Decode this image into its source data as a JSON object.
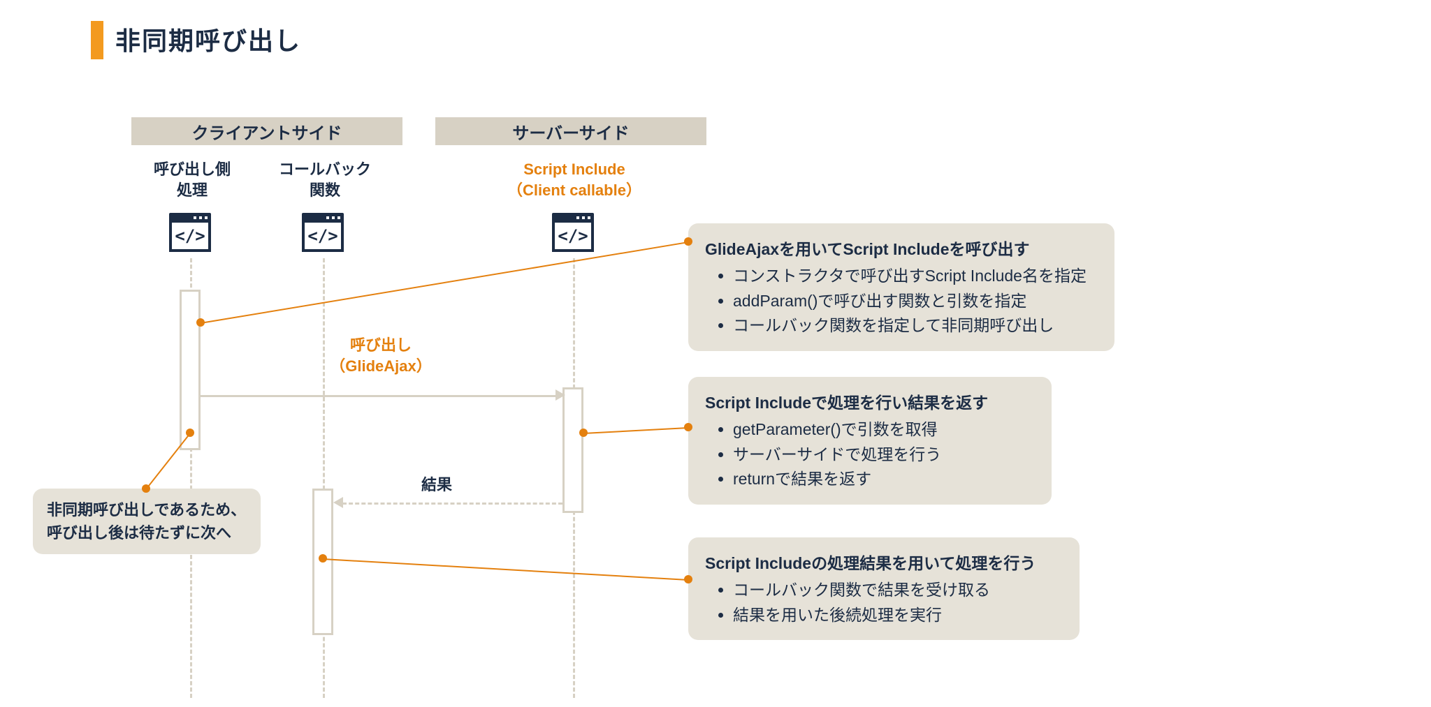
{
  "title": "非同期呼び出し",
  "headers": {
    "client": "クライアントサイド",
    "server": "サーバーサイド"
  },
  "lanes": {
    "caller": "呼び出し側\n処理",
    "callback": "コールバック\n関数",
    "server": "Script Include\n（Client callable）"
  },
  "messages": {
    "call": "呼び出し\n（GlideAjax）",
    "result": "結果"
  },
  "annotations": {
    "a1": {
      "title": "GlideAjaxを用いてScript Includeを呼び出す",
      "items": [
        "コンストラクタで呼び出すScript Include名を指定",
        "addParam()で呼び出す関数と引数を指定",
        "コールバック関数を指定して非同期呼び出し"
      ]
    },
    "a2": {
      "title": "Script Includeで処理を行い結果を返す",
      "items": [
        "getParameter()で引数を取得",
        "サーバーサイドで処理を行う",
        "returnで結果を返す"
      ]
    },
    "a3": {
      "title": "Script Includeの処理結果を用いて処理を行う",
      "items": [
        "コールバック関数で結果を受け取る",
        "結果を用いた後続処理を実行"
      ]
    },
    "a4": {
      "text": "非同期呼び出しであるため、\n呼び出し後は待たずに次へ"
    }
  }
}
